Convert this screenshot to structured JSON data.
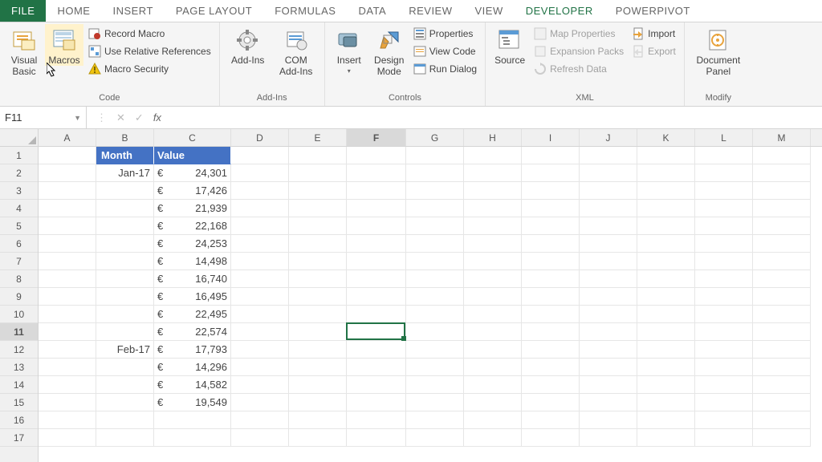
{
  "tabs": {
    "file": "FILE",
    "list": [
      "HOME",
      "INSERT",
      "PAGE LAYOUT",
      "FORMULAS",
      "DATA",
      "REVIEW",
      "VIEW",
      "DEVELOPER",
      "POWERPIVOT"
    ],
    "active_index": 7
  },
  "ribbon": {
    "code": {
      "visual_basic": "Visual Basic",
      "macros": "Macros",
      "record_macro": "Record Macro",
      "use_relative": "Use Relative References",
      "macro_security": "Macro Security",
      "group_label": "Code"
    },
    "addins": {
      "add_ins": "Add-Ins",
      "com_add_ins": "COM Add-Ins",
      "group_label": "Add-Ins"
    },
    "controls": {
      "insert": "Insert",
      "design_mode": "Design Mode",
      "properties": "Properties",
      "view_code": "View Code",
      "run_dialog": "Run Dialog",
      "group_label": "Controls"
    },
    "xml": {
      "source": "Source",
      "map_properties": "Map Properties",
      "expansion_packs": "Expansion Packs",
      "refresh_data": "Refresh Data",
      "import": "Import",
      "export": "Export",
      "group_label": "XML"
    },
    "modify": {
      "document_panel": "Document Panel",
      "group_label": "Modify"
    }
  },
  "formula_bar": {
    "name_box": "F11",
    "formula": ""
  },
  "columns": [
    "A",
    "B",
    "C",
    "D",
    "E",
    "F",
    "G",
    "H",
    "I",
    "J",
    "K",
    "L",
    "M"
  ],
  "selected_column_index": 5,
  "row_count": 17,
  "selected_row": 11,
  "active_cell": {
    "row": 11,
    "colIndex": 5
  },
  "headers": {
    "B": "Month",
    "C": "Value"
  },
  "rows": [
    {
      "n": 2,
      "B": "Jan-17",
      "sym": "€",
      "val": "24,301"
    },
    {
      "n": 3,
      "B": "",
      "sym": "€",
      "val": "17,426"
    },
    {
      "n": 4,
      "B": "",
      "sym": "€",
      "val": "21,939"
    },
    {
      "n": 5,
      "B": "",
      "sym": "€",
      "val": "22,168"
    },
    {
      "n": 6,
      "B": "",
      "sym": "€",
      "val": "24,253"
    },
    {
      "n": 7,
      "B": "",
      "sym": "€",
      "val": "14,498"
    },
    {
      "n": 8,
      "B": "",
      "sym": "€",
      "val": "16,740"
    },
    {
      "n": 9,
      "B": "",
      "sym": "€",
      "val": "16,495"
    },
    {
      "n": 10,
      "B": "",
      "sym": "€",
      "val": "22,495"
    },
    {
      "n": 11,
      "B": "",
      "sym": "€",
      "val": "22,574"
    },
    {
      "n": 12,
      "B": "Feb-17",
      "sym": "€",
      "val": "17,793"
    },
    {
      "n": 13,
      "B": "",
      "sym": "€",
      "val": "14,296"
    },
    {
      "n": 14,
      "B": "",
      "sym": "€",
      "val": "14,582"
    },
    {
      "n": 15,
      "B": "",
      "sym": "€",
      "val": "19,549"
    }
  ]
}
